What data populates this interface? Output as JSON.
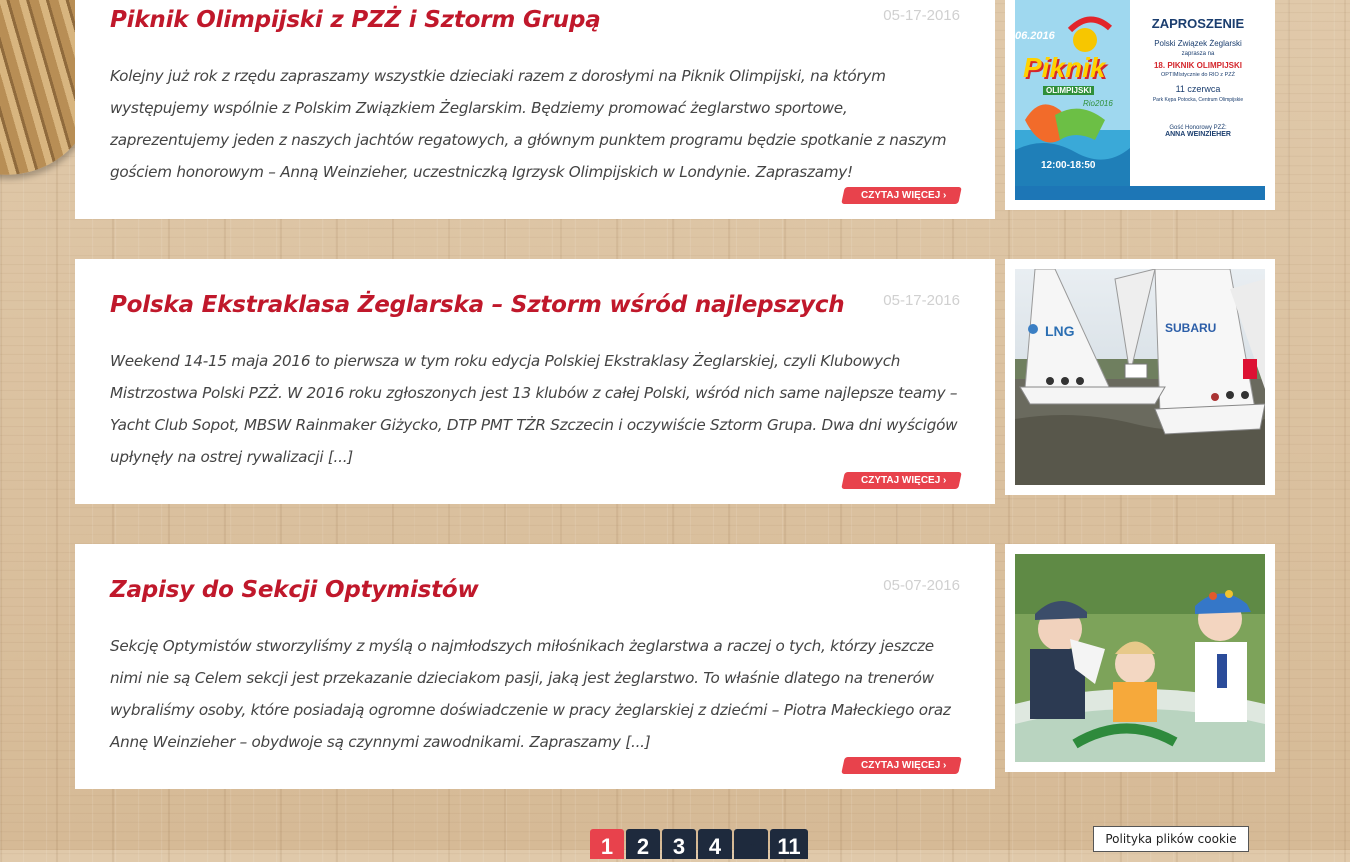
{
  "posts": [
    {
      "title": "Piknik Olimpijski z PZŻ i Sztorm Grupą",
      "date": "05-17-2016",
      "excerpt": "Kolejny już rok z rzędu zapraszamy wszystkie dzieciaki razem z dorosłymi na Piknik Olimpijski, na którym występujemy wspólnie z Polskim Związkiem Żeglarskim. Będziemy promować żeglarstwo sportowe, zaprezentujemy jeden z naszych jachtów regatowych, a głównym punktem programu będzie spotkanie z naszym gościem honorowym – Anną Weinzieher, uczestniczką Igrzysk Olimpijskich w Londynie. Zapraszamy!",
      "more_label": "CZYTAJ WIĘCEJ ›",
      "poster": {
        "date_text": "06.2016",
        "piknik": "Piknik",
        "olimpijski": "OLIMPIJSKI",
        "rio": "Rio2016",
        "heading": "ZAPROSZENIE",
        "org": "Polski Związek Żeglarski",
        "invites": "zaprasza na",
        "event": "18. PIKNIK OLIMPIJSKI",
        "sub": "OPTIMIstycznie do RIO z PZŻ",
        "day": "11 czerwca",
        "place": "Park Kępa Potocka, Centrum Olimpijskie",
        "guest_label": "Gość Honorowy PZŻ:",
        "guest": "ANNA WEINZIEHER",
        "time": "12:00-18:50"
      }
    },
    {
      "title": "Polska Ekstraklasa Żeglarska – Sztorm wśród najlepszych",
      "date": "05-17-2016",
      "excerpt": "Weekend 14-15 maja 2016 to pierwsza w tym roku edycja Polskiej Ekstraklasy Żeglarskiej, czyli Klubowych Mistrzostwa Polski PZŻ. W 2016 roku zgłoszonych jest 13 klubów z całej Polski, wśród nich same najlepsze teamy – Yacht Club Sopot, MBSW Rainmaker Giżycko, DTP PMT TŻR Szczecin i oczywiście Sztorm Grupa. Dwa dni wyścigów upłynęły na ostrej rywalizacji [...]",
      "more_label": "CZYTAJ WIĘCEJ ›",
      "sail_labels": [
        "LNG",
        "SUBARU"
      ]
    },
    {
      "title": "Zapisy do Sekcji Optymistów",
      "date": "05-07-2016",
      "excerpt": "Sekcję Optymistów stworzyliśmy z myślą o najmłodszych miłośnikach żeglarstwa a raczej o tych, którzy jeszcze nimi nie są Celem sekcji jest przekazanie dzieciakom pasji, jaką jest żeglarstwo. To właśnie dlatego na trenerów wybraliśmy osoby, które posiadają ogromne doświadczenie w pracy żeglarskiej z dziećmi – Piotra Małeckiego oraz Annę Weinzieher – obydwoje są czynnymi zawodnikami. Zapraszamy [...]",
      "more_label": "CZYTAJ WIĘCEJ ›"
    }
  ],
  "pagination": {
    "pages": [
      "1",
      "2",
      "3",
      "4",
      "...",
      "11"
    ],
    "active": "1"
  },
  "cookie": {
    "label": "Polityka plików cookie"
  },
  "colors": {
    "accent": "#e8424c",
    "title": "#c0182b",
    "pager": "#1e2a3d"
  }
}
